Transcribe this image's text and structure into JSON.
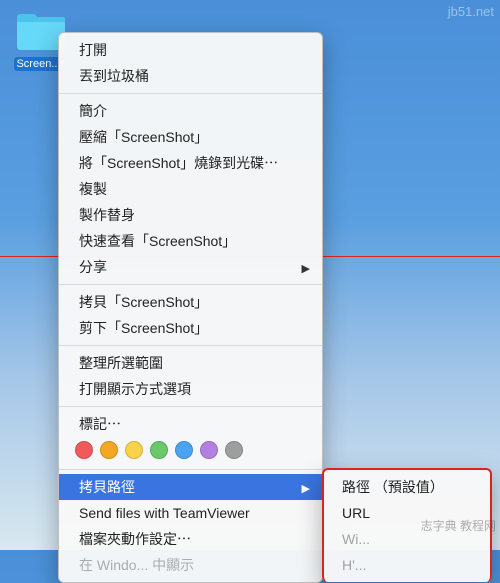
{
  "desktop": {
    "icon_label": "Screen...t"
  },
  "menu": {
    "open": "打開",
    "trash": "丟到垃圾桶",
    "info": "簡介",
    "compress": "壓縮「ScreenShot」",
    "burn": "將「ScreenShot」燒錄到光碟⋯",
    "duplicate": "複製",
    "alias": "製作替身",
    "quicklook": "快速查看「ScreenShot」",
    "share": "分享",
    "copy": "拷貝「ScreenShot」",
    "cut": "剪下「ScreenShot」",
    "cleanup": "整理所選範圍",
    "viewopts": "打開顯示方式選項",
    "tags_label": "標記⋯",
    "copy_path": "拷貝路徑",
    "teamviewer": "Send files with TeamViewer",
    "folder_actions": "檔案夾動作設定⋯",
    "windows_partial": "在 Windo... 中顯示"
  },
  "submenu": {
    "path_default": "路徑 （預設值）",
    "url": "URL",
    "wi_partial": "Wi...",
    "h_partial": "H'..."
  },
  "tags": {
    "colors": [
      "#f05a5a",
      "#f5a623",
      "#f8d24a",
      "#6ac76a",
      "#4aa3f0",
      "#b480e0",
      "#9e9e9e"
    ]
  },
  "watermarks": {
    "w1": "jb51.net",
    "w2": "志字典 教程网"
  }
}
